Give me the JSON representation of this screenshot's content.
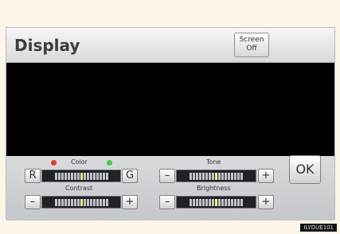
{
  "header": {
    "title": "Display",
    "screen_off_line1": "Screen",
    "screen_off_line2": "Off"
  },
  "controls": {
    "color": {
      "label": "Color",
      "left": "R",
      "right": "G"
    },
    "tone": {
      "label": "Tone",
      "left": "–",
      "right": "+"
    },
    "contrast": {
      "label": "Contrast",
      "left": "–",
      "right": "+"
    },
    "brightness": {
      "label": "Brightness",
      "left": "–",
      "right": "+"
    },
    "ok": "OK"
  },
  "corner_code": "ILYDUE101"
}
